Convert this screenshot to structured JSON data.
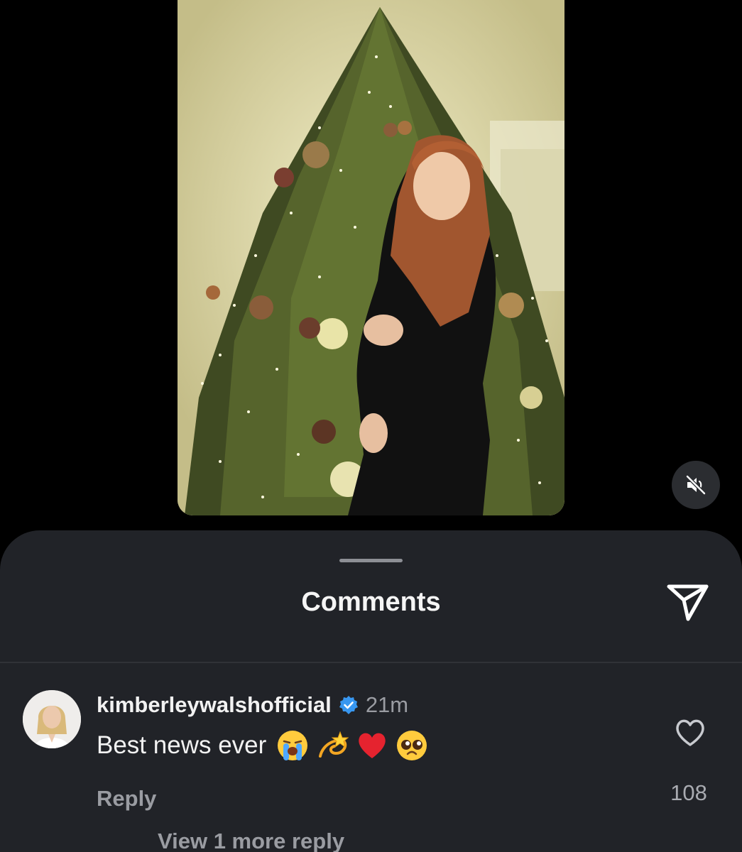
{
  "media": {
    "mute_icon": "speaker-muted-icon"
  },
  "sheet": {
    "title": "Comments",
    "share_icon": "send-icon"
  },
  "comment": {
    "username": "kimberleywalshofficial",
    "verified_icon": "verified-badge-icon",
    "timestamp": "21m",
    "text": "Best news ever",
    "emojis": [
      "loudly-crying-face",
      "dizzy",
      "red-heart",
      "pleading-face"
    ],
    "reply_label": "Reply",
    "like_icon": "heart-outline-icon",
    "like_count": "108",
    "view_more_label": "View 1 more reply"
  },
  "colors": {
    "background": "#000000",
    "sheet": "#212328",
    "text_primary": "#f2f2f2",
    "text_secondary": "#9a9ca2",
    "verified_blue": "#3897f0"
  }
}
